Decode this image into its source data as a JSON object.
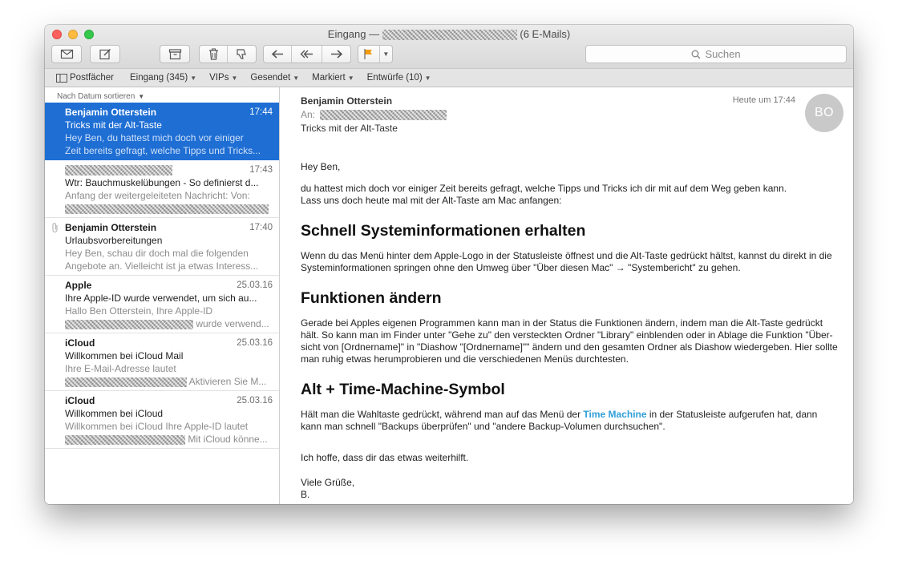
{
  "window": {
    "title_prefix": "Eingang —",
    "title_suffix": "(6 E-Mails)"
  },
  "toolbar": {
    "search_placeholder": "Suchen"
  },
  "favorites": [
    {
      "label": "Postfächer"
    },
    {
      "label": "Eingang (345)"
    },
    {
      "label": "VIPs"
    },
    {
      "label": "Gesendet"
    },
    {
      "label": "Markiert"
    },
    {
      "label": "Entwürfe (10)"
    }
  ],
  "list": {
    "sort_label": "Nach Datum sortieren",
    "messages": [
      {
        "from": "Benjamin Otterstein",
        "date": "17:44",
        "subject": "Tricks mit der Alt-Taste",
        "preview1": "Hey Ben, du hattest mich doch vor einiger",
        "preview2": "Zeit bereits gefragt, welche Tipps und Tricks..."
      },
      {
        "from": "",
        "date": "17:43",
        "subject": "Wtr: Bauchmuskelübungen - So definierst d...",
        "preview1": "Anfang der weitergeleiteten Nachricht: Von:",
        "preview2": ""
      },
      {
        "from": "Benjamin Otterstein",
        "date": "17:40",
        "subject": "Urlaubsvorbereitungen",
        "preview1": "Hey Ben, schau dir doch mal die folgenden",
        "preview2": "Angebote an. Vielleicht ist ja etwas Interess..."
      },
      {
        "from": "Apple",
        "date": "25.03.16",
        "subject": "Ihre Apple-ID wurde verwendet, um sich au...",
        "preview1": "Hallo Ben Otterstein, Ihre Apple-ID",
        "preview2": "wurde verwend..."
      },
      {
        "from": "iCloud",
        "date": "25.03.16",
        "subject": "Willkommen bei iCloud Mail",
        "preview1": "Ihre E-Mail-Adresse lautet",
        "preview2": "Aktivieren Sie M..."
      },
      {
        "from": "iCloud",
        "date": "25.03.16",
        "subject": "Willkommen bei iCloud",
        "preview1": "Willkommen bei iCloud Ihre Apple-ID lautet",
        "preview2": "Mit iCloud könne..."
      }
    ]
  },
  "reader": {
    "from": "Benjamin Otterstein",
    "to_label": "An:",
    "subject": "Tricks mit der Alt-Taste",
    "time": "Heute um 17:44",
    "avatar_initials": "BO",
    "greeting": "Hey Ben,",
    "intro_line1": "du hattest mich doch vor einiger Zeit bereits gefragt, welche Tipps und Tricks ich dir mit auf dem Weg geben kann.",
    "intro_line2": "Lass uns doch heute mal mit der Alt-Taste am Mac anfangen:",
    "h1": "Schnell Systeminformationen erhalten",
    "p1": "Wenn du das Menü hinter dem Apple-Logo in der Statusleiste öffnest und die Alt-Taste gedrückt hältst, kannst du direkt in die Systeminformationen springen ohne den Umweg über \"Über diesen Mac\" → \"Systembericht\" zu gehen.",
    "h2": "Funktionen ändern",
    "p2": "Gerade bei Apples eigenen Programmen kann man in der Status die Funktionen ändern, indem man die Alt-Taste gedrückt hält. So kann man im Finder unter \"Gehe zu\" den versteckten Ordner \"Library\" einblenden oder in Ablage die Funktion \"Über-sicht von [Ordnername]\"  in \"Diashow \"[Ordnername]\"\" ändern und den gesamten Ordner als Diashow wiedergeben. Hier sollte man ruhig etwas herumprobieren und die verschiedenen Menüs durchtesten.",
    "h3": "Alt + Time-Machine-Symbol",
    "p3_before": "Hält man die Wahltaste gedrückt, während man auf das Menü der ",
    "p3_link": "Time Machine",
    "p3_after": " in der Statusleiste aufgerufen hat, dann kann man schnell \"Backups überprüfen\" und \"andere Backup-Volumen durchsuchen\".",
    "closing": "Ich hoffe, dass dir das etwas weiterhilft.",
    "sign1": "Viele Grüße,",
    "sign2": "B."
  },
  "colors": {
    "selection": "#1e6ed4",
    "link": "#2f9fd8",
    "flag": "#f39c12"
  }
}
